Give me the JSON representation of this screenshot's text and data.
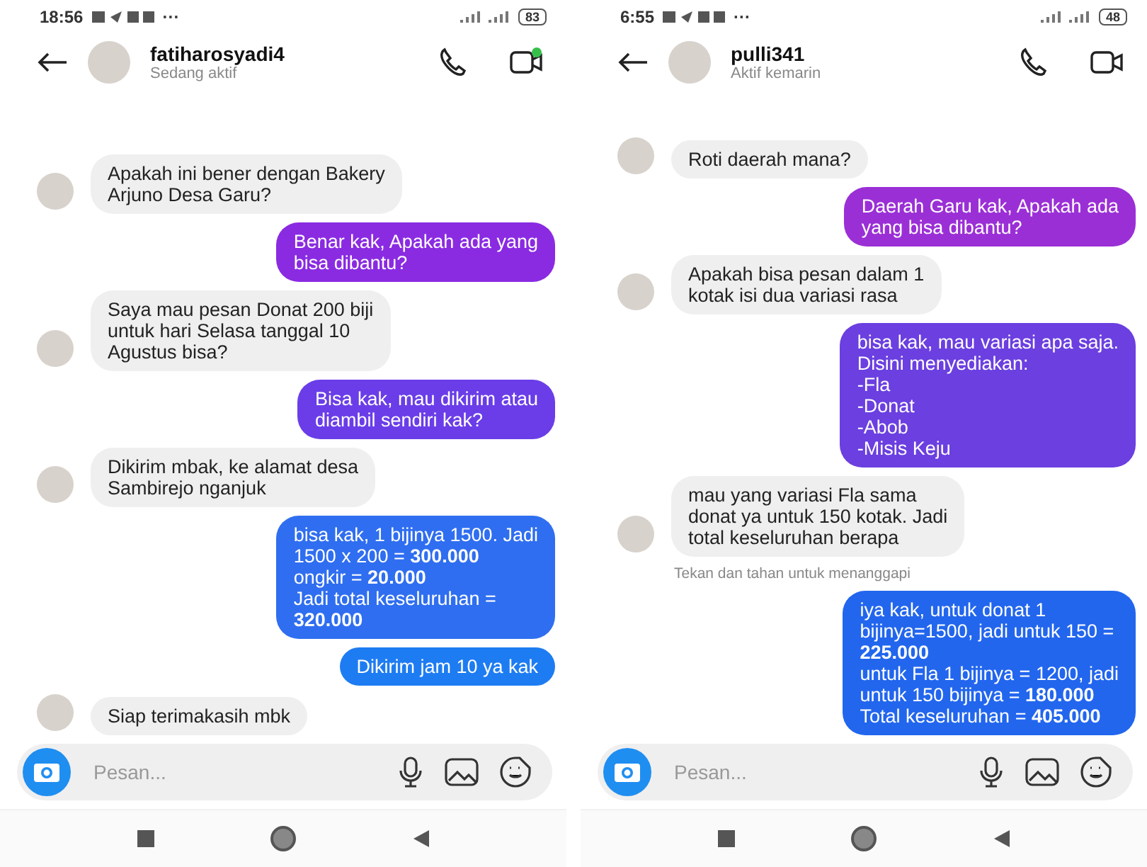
{
  "phones": [
    {
      "status_bar": {
        "time": "18:56",
        "more": "···",
        "battery": "83"
      },
      "header": {
        "name": "fatiharosyadi4",
        "status": "Sedang aktif",
        "video_dot": true
      },
      "messages": [
        {
          "kind": "received",
          "text": "Apakah ini bener dengan Bakery\nArjuno Desa Garu?"
        },
        {
          "kind": "sent",
          "color": "#8a2be2",
          "text": "Benar kak, Apakah ada yang\nbisa dibantu?"
        },
        {
          "kind": "received",
          "text": "Saya mau pesan Donat 200 biji\nuntuk hari Selasa tanggal 10\nAgustus bisa?"
        },
        {
          "kind": "sent",
          "color": "#6a3de8",
          "text": "Bisa kak, mau dikirim atau\ndiambil sendiri kak?"
        },
        {
          "kind": "received",
          "text": "Dikirim mbak, ke alamat desa\nSambirejo nganjuk"
        },
        {
          "kind": "sent",
          "color": "#2f6ef0",
          "text": "bisa kak, 1 bijinya 1500. Jadi\n1500 x 200 = **300.000**\nongkir = **20.000**\nJadi total keseluruhan =\n**320.000**"
        },
        {
          "kind": "sent",
          "color": "#1e7cf2",
          "text": "Dikirim jam 10 ya kak"
        },
        {
          "kind": "received",
          "text": "Siap terimakasih mbk"
        }
      ],
      "composer": {
        "placeholder": "Pesan..."
      }
    },
    {
      "status_bar": {
        "time": "6:55",
        "more": "···",
        "battery": "48"
      },
      "header": {
        "name": "pulli341",
        "status": "Aktif kemarin",
        "video_dot": false
      },
      "messages": [
        {
          "kind": "received",
          "text": "Roti daerah mana?"
        },
        {
          "kind": "sent",
          "color": "#9b2fd6",
          "text": "Daerah Garu kak, Apakah ada\nyang bisa dibantu?"
        },
        {
          "kind": "received",
          "text": "Apakah bisa pesan dalam 1\nkotak isi dua variasi rasa"
        },
        {
          "kind": "sent",
          "color": "#6b3fe0",
          "text": "bisa kak, mau variasi apa saja.\nDisini menyediakan:\n-Fla\n-Donat\n-Abob\n-Misis Keju"
        },
        {
          "kind": "received",
          "text": "mau yang variasi Fla sama\ndonat ya untuk 150 kotak. Jadi\ntotal keseluruhan berapa"
        },
        {
          "kind": "hint",
          "text": "Tekan dan tahan untuk menanggapi"
        },
        {
          "kind": "sent",
          "color": "#2266ee",
          "text": "iya kak, untuk donat 1\nbijinya=1500, jadi untuk 150 =\n**225.000**\nuntuk Fla 1 bijinya = 1200, jadi\nuntuk 150 bijinya = **180.000**\nTotal keseluruhan = **405.000**"
        }
      ],
      "composer": {
        "placeholder": "Pesan..."
      }
    }
  ]
}
